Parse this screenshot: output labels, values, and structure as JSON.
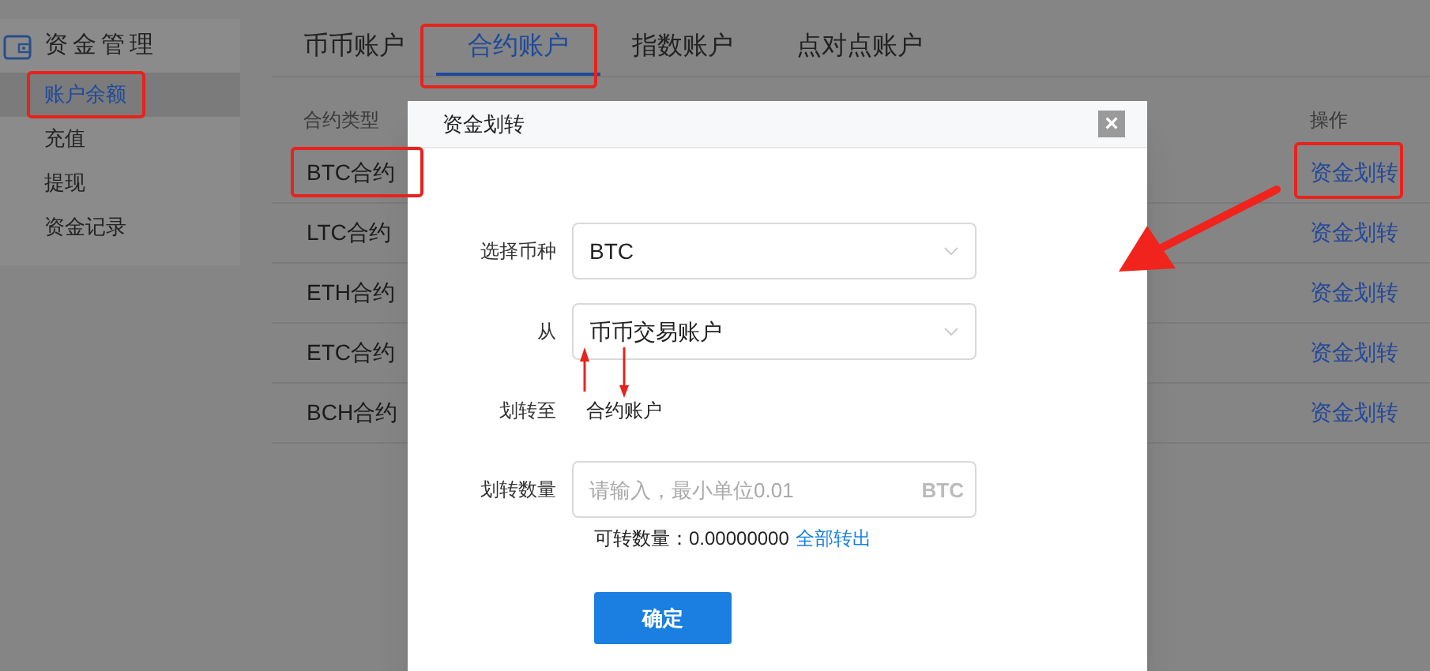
{
  "sidebar": {
    "title": "资金管理",
    "items": [
      {
        "label": "账户余额",
        "selected": true
      },
      {
        "label": "充值",
        "selected": false
      },
      {
        "label": "提现",
        "selected": false
      },
      {
        "label": "资金记录",
        "selected": false
      }
    ]
  },
  "tabs": [
    {
      "label": "币币账户",
      "selected": false
    },
    {
      "label": "合约账户",
      "selected": true
    },
    {
      "label": "指数账户",
      "selected": false
    },
    {
      "label": "点对点账户",
      "selected": false
    }
  ],
  "table": {
    "columns": [
      "合约类型",
      "操作"
    ],
    "rows": [
      {
        "type": "BTC合约",
        "action": "资金划转"
      },
      {
        "type": "LTC合约",
        "action": "资金划转"
      },
      {
        "type": "ETH合约",
        "action": "资金划转"
      },
      {
        "type": "ETC合约",
        "action": "资金划转"
      },
      {
        "type": "BCH合约",
        "action": "资金划转"
      }
    ]
  },
  "dialog": {
    "title": "资金划转",
    "close": "×",
    "currency": {
      "label": "选择币种",
      "value": "BTC"
    },
    "from": {
      "label": "从",
      "value": "币币交易账户"
    },
    "to": {
      "label": "划转至",
      "value": "合约账户"
    },
    "amount": {
      "label": "划转数量",
      "placeholder": "请输入，最小单位0.01",
      "unit": "BTC"
    },
    "available": {
      "label": "可转数量：0.00000000",
      "link": "全部转出"
    },
    "confirm": "确定"
  }
}
